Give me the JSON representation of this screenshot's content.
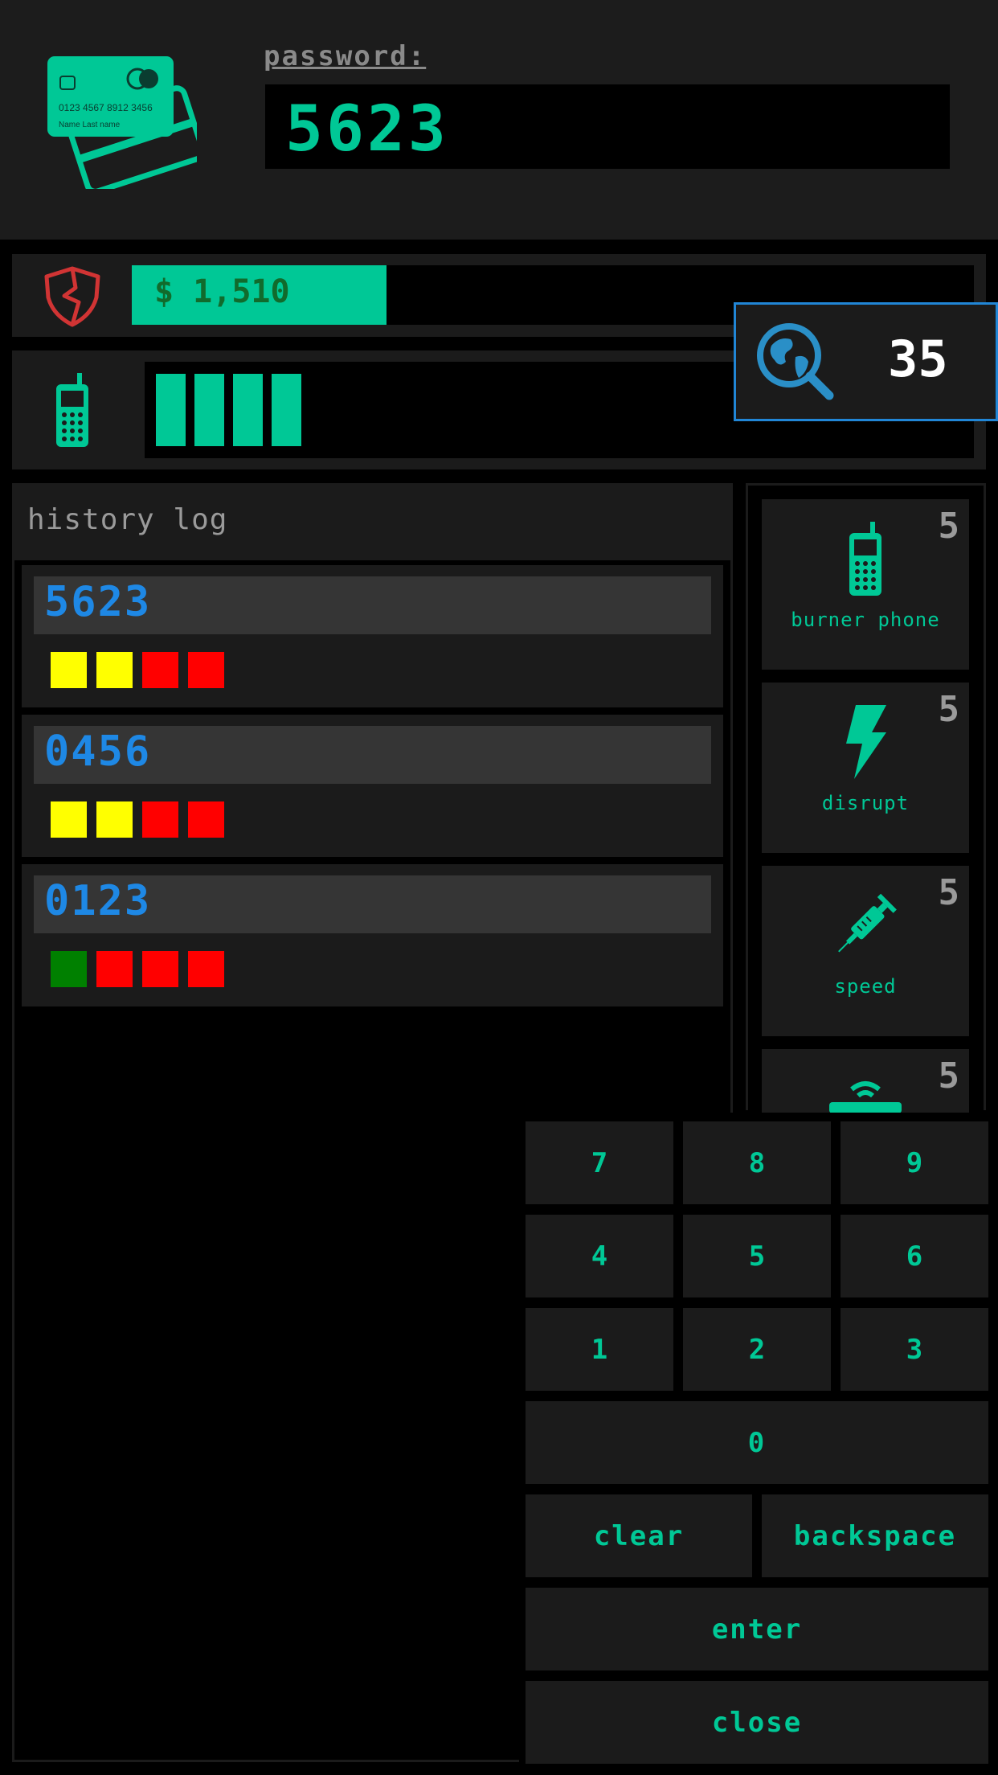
{
  "header": {
    "card_icon": "credit-card-icon",
    "card_number": "0123  4567  8912  3456",
    "card_name": "Name   Last name",
    "password_label": "password:",
    "password_value": "5623"
  },
  "money": {
    "icon": "shield-icon",
    "text": "$ 1,510",
    "icon_color": "#d13434"
  },
  "signal": {
    "icon": "phone-icon",
    "bars_filled": 4
  },
  "search": {
    "icon": "globe-search-icon",
    "value": "35"
  },
  "history": {
    "title": "history log",
    "entries": [
      {
        "code": "5623",
        "marks": [
          "yellow",
          "yellow",
          "red",
          "red"
        ]
      },
      {
        "code": "0456",
        "marks": [
          "yellow",
          "yellow",
          "red",
          "red"
        ]
      },
      {
        "code": "0123",
        "marks": [
          "green",
          "red",
          "red",
          "red"
        ]
      }
    ]
  },
  "items": [
    {
      "label": "burner phone",
      "count": "5",
      "icon": "phone-icon"
    },
    {
      "label": "disrupt",
      "count": "5",
      "icon": "lightning-icon"
    },
    {
      "label": "speed",
      "count": "5",
      "icon": "syringe-icon"
    },
    {
      "label": "",
      "count": "5",
      "icon": "router-icon"
    }
  ],
  "keypad": {
    "k7": "7",
    "k8": "8",
    "k9": "9",
    "k4": "4",
    "k5": "5",
    "k6": "6",
    "k1": "1",
    "k2": "2",
    "k3": "3",
    "k0": "0",
    "clear": "clear",
    "backspace": "backspace",
    "enter": "enter",
    "close": "close"
  },
  "colors": {
    "accent": "#00c896",
    "code_blue": "#1e88e5",
    "mark_yellow": "#ffff00",
    "mark_red": "#ff0000",
    "mark_green": "#008000"
  }
}
